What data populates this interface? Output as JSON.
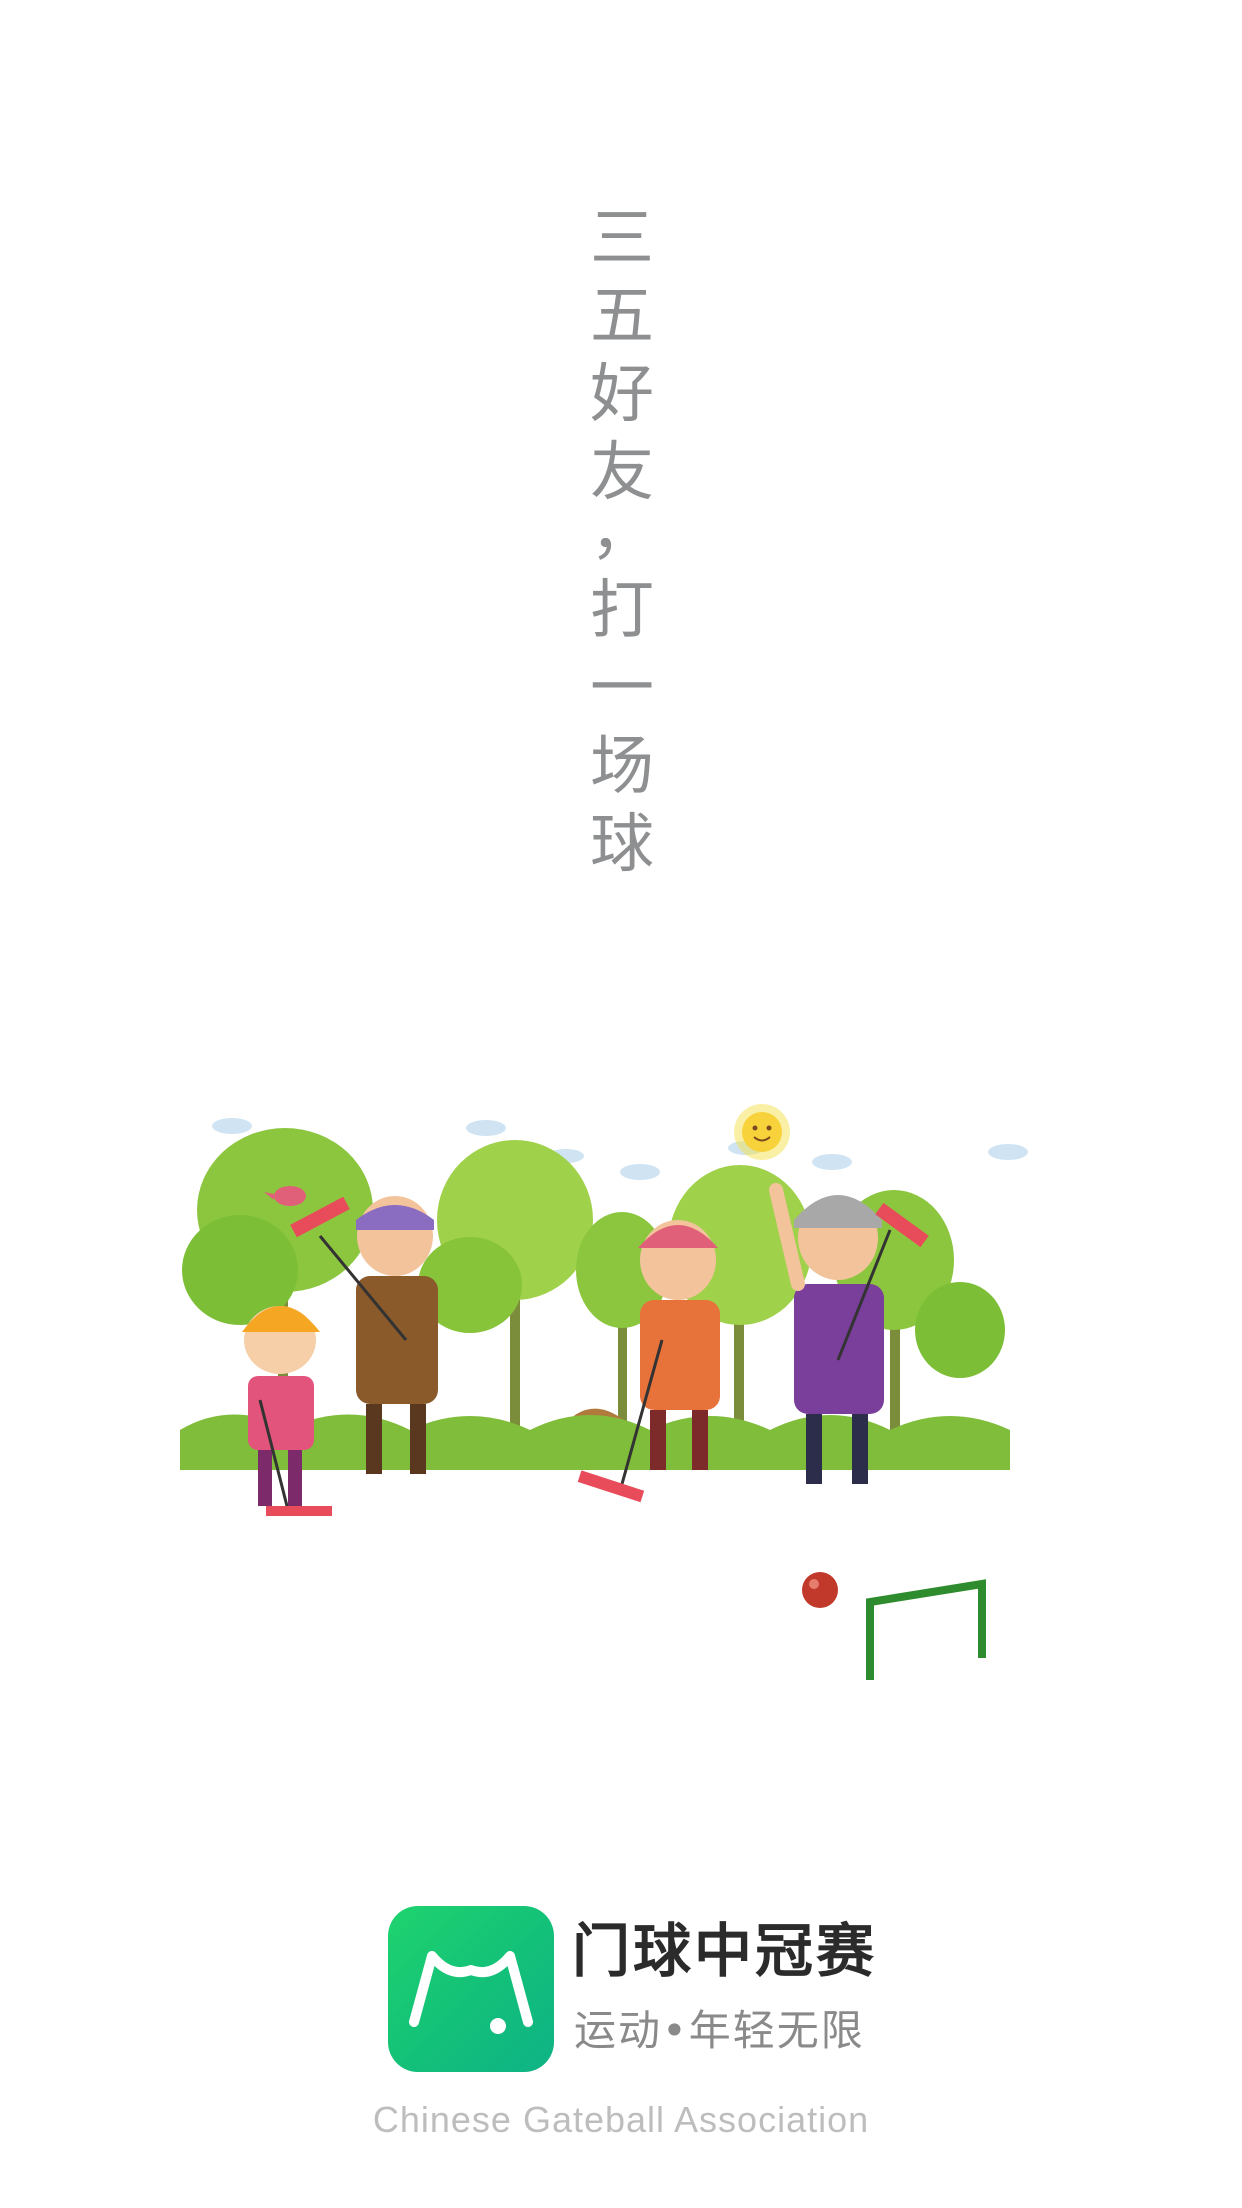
{
  "slogan": {
    "glyphs": [
      "三",
      "五",
      "好",
      "友",
      "，",
      "打",
      "一",
      "场",
      "球"
    ]
  },
  "brand": {
    "app_name": "门球中冠赛",
    "tagline": "运动•年轻无限",
    "english_name": "Chinese Gateball Association",
    "logo_icon": "gate-arch-icon"
  },
  "illustration": {
    "subject": "elderly-gateball-players-scene"
  },
  "colors": {
    "brand_green": "#18c46f",
    "slogan_gray": "#8d8f90",
    "name_dark": "#2b2b2b",
    "tagline_gray": "#8a8a8a",
    "english_gray": "#bdbdbd"
  }
}
